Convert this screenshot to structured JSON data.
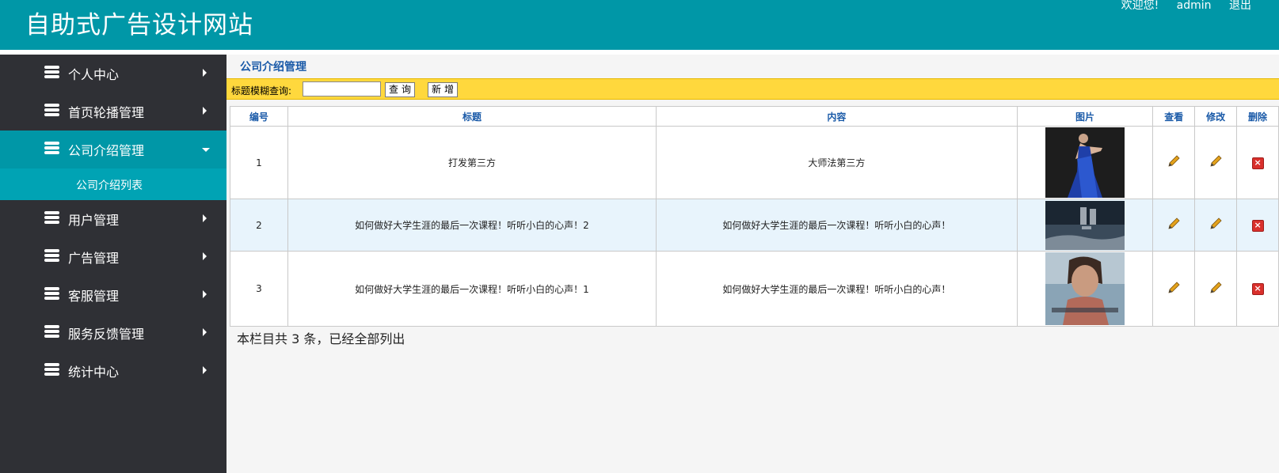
{
  "header": {
    "site_title": "自助式广告设计网站",
    "welcome": "欢迎您!",
    "username": "admin",
    "logout": "退出"
  },
  "sidebar": {
    "items": [
      {
        "label": "个人中心",
        "state": "collapsed"
      },
      {
        "label": "首页轮播管理",
        "state": "collapsed"
      },
      {
        "label": "公司介绍管理",
        "state": "expanded"
      },
      {
        "label": "用户管理",
        "state": "collapsed"
      },
      {
        "label": "广告管理",
        "state": "collapsed"
      },
      {
        "label": "客服管理",
        "state": "collapsed"
      },
      {
        "label": "服务反馈管理",
        "state": "collapsed"
      },
      {
        "label": "统计中心",
        "state": "collapsed"
      }
    ],
    "sub_item": "公司介绍列表"
  },
  "main": {
    "section_title": "公司介绍管理",
    "search": {
      "label": "标题模糊查询:",
      "value": "",
      "query_button": "查询",
      "add_button": "新增"
    },
    "table": {
      "columns": [
        "编号",
        "标题",
        "内容",
        "图片",
        "查看",
        "修改",
        "删除"
      ],
      "rows": [
        {
          "id": "1",
          "title": "打发第三方",
          "content": "大师法第三方",
          "image": "woman-blue-dress"
        },
        {
          "id": "2",
          "title": "如何做好大学生涯的最后一次课程！听听小白的心声！2",
          "content": "如何做好大学生涯的最后一次课程！听听小白的心声！",
          "image": "movie-poster-dark"
        },
        {
          "id": "3",
          "title": "如何做好大学生涯的最后一次课程！听听小白的心声！1",
          "content": "如何做好大学生涯的最后一次课程！听听小白的心声！",
          "image": "child-portrait"
        }
      ]
    },
    "footer_note": "本栏目共 3 条，已经全部列出"
  },
  "colors": {
    "header_bg": "#0097a7",
    "sidebar_bg": "#2f3035",
    "active_bg": "#0097a7",
    "sub_bg": "#00a3b4",
    "search_bar_bg": "#ffd83d",
    "header_text": "#1a5aa8",
    "delete_red": "#d9302c"
  },
  "icons": {
    "menu": "stack-icon",
    "view": "pencil-icon",
    "edit": "pencil-icon",
    "delete": "close-box-icon"
  }
}
